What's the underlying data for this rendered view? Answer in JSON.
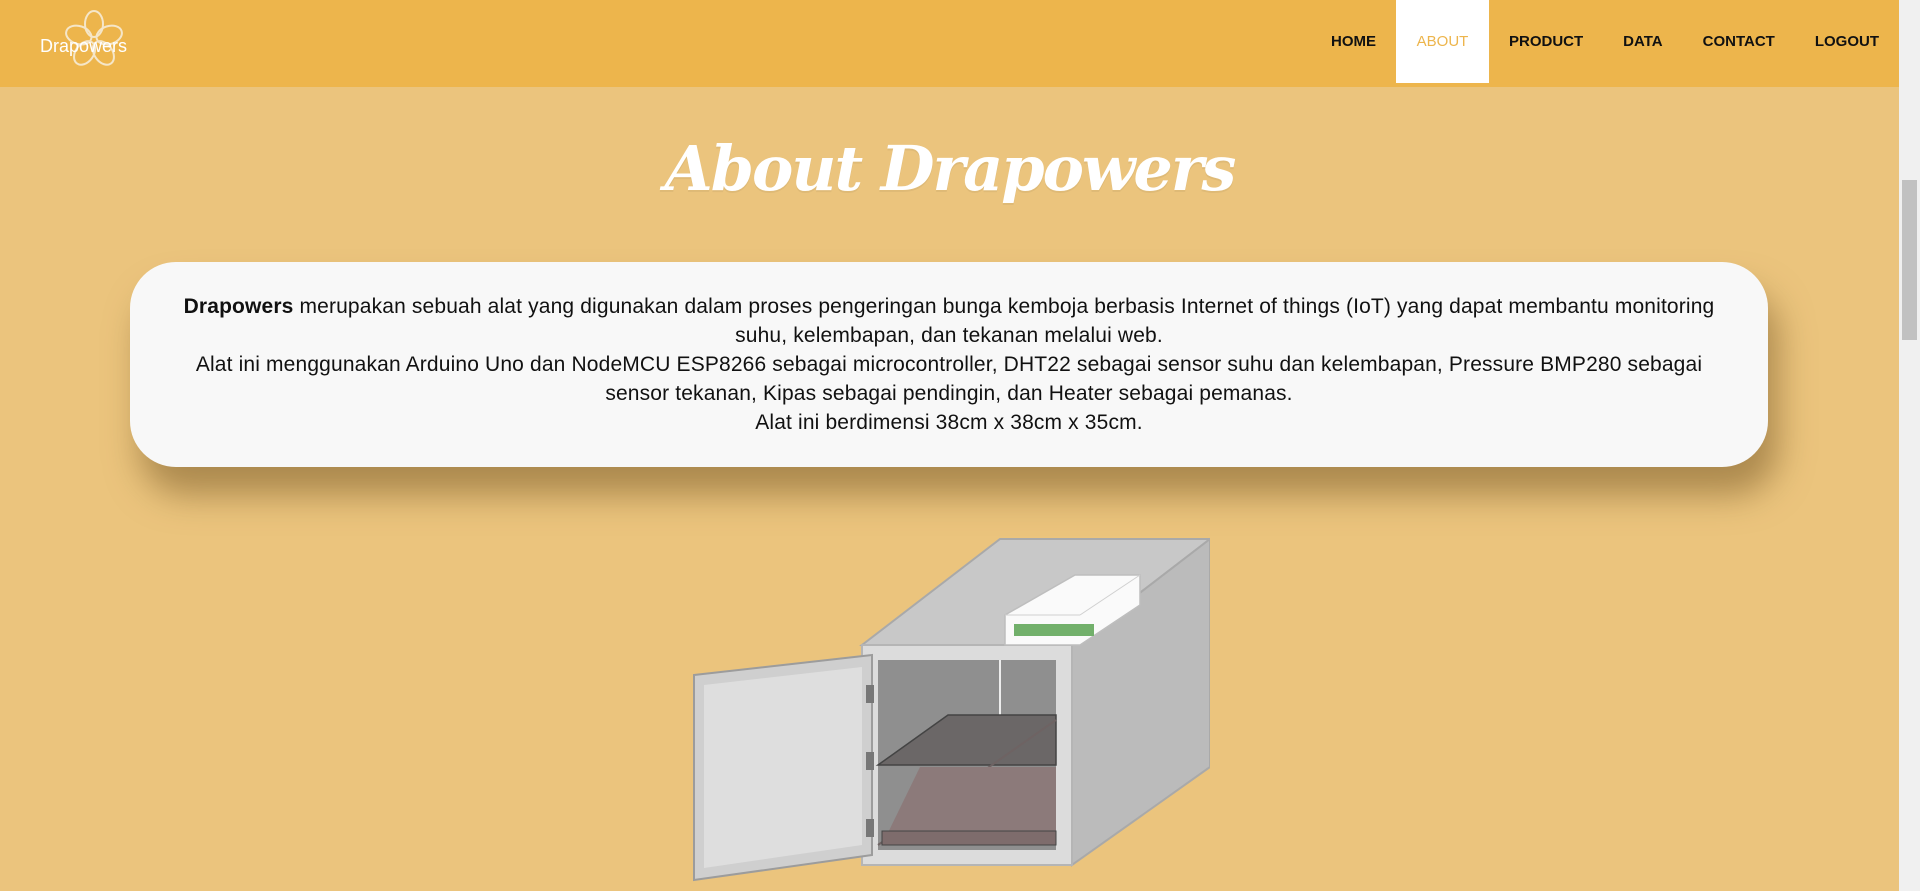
{
  "brand": {
    "name": "Drapowers"
  },
  "nav": {
    "items": [
      {
        "label": "HOME",
        "active": false
      },
      {
        "label": "ABOUT",
        "active": true
      },
      {
        "label": "PRODUCT",
        "active": false
      },
      {
        "label": "DATA",
        "active": false
      },
      {
        "label": "CONTACT",
        "active": false
      },
      {
        "label": "LOGOUT",
        "active": false
      }
    ]
  },
  "page": {
    "title": "About Drapowers"
  },
  "about": {
    "bold_name": "Drapowers",
    "line1": " merupakan sebuah alat yang digunakan dalam proses pengeringan bunga kemboja berbasis Internet of things (IoT) yang dapat membantu monitoring suhu, kelembapan, dan tekanan melalui web.",
    "line2": "Alat ini menggunakan Arduino Uno dan NodeMCU ESP8266 sebagai microcontroller, DHT22 sebagai sensor suhu dan kelembapan, Pressure BMP280 sebagai sensor tekanan, Kipas sebagai pendingin, dan Heater sebagai pemanas.",
    "line3": "Alat ini berdimensi 38cm x 38cm x 35cm."
  },
  "colors": {
    "navbar": "#EDB54C",
    "background": "#EBC47D",
    "card": "#F8F8F8",
    "accent": "#EDB54C"
  },
  "icons": {
    "brand_logo": "flower-outline-icon"
  }
}
